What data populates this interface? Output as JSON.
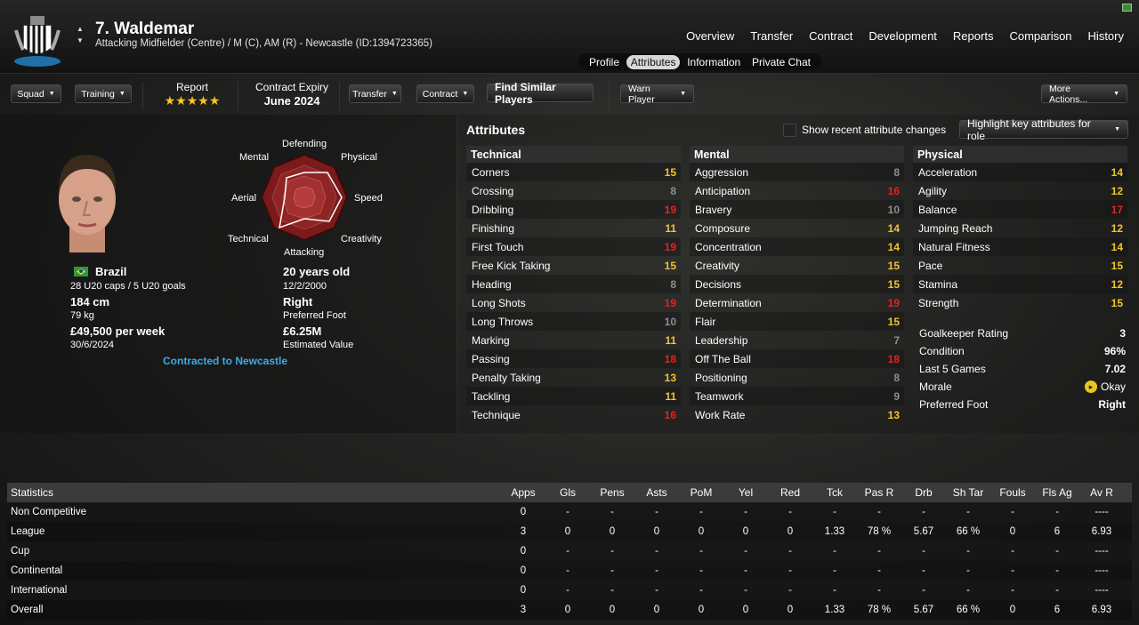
{
  "colors": {
    "accent_yellow": "#f0c52b",
    "accent_red": "#e02424",
    "grey": "#8d8d8d",
    "link_blue": "#3fa9e8"
  },
  "header": {
    "player_name": "7. Waldemar",
    "subtitle": "Attacking Midfielder (Centre) / M (C), AM (R) - Newcastle (ID:1394723365)",
    "nav": [
      "Overview",
      "Transfer",
      "Contract",
      "Development",
      "Reports",
      "Comparison",
      "History"
    ],
    "tabs": [
      "Profile",
      "Attributes",
      "Information",
      "Private Chat"
    ],
    "active_tab": "Attributes"
  },
  "toolbar": {
    "squad": "Squad",
    "training": "Training",
    "report_label": "Report",
    "report_stars": 5,
    "contract_label": "Contract Expiry",
    "contract_value": "June 2024",
    "transfer": "Transfer",
    "contract": "Contract",
    "find_similar": "Find Similar Players",
    "warn": "Warn Player",
    "more": "More Actions..."
  },
  "radar": {
    "labels": [
      "Defending",
      "Physical",
      "Speed",
      "Creativity",
      "Attacking",
      "Technical",
      "Aerial",
      "Mental"
    ]
  },
  "profile": {
    "nationality": "Brazil",
    "caps": "28 U20 caps / 5 U20 goals",
    "height": "184 cm",
    "weight": "79 kg",
    "wage": "£49,500 per week",
    "wage_date": "30/6/2024",
    "age": "20 years old",
    "dob": "12/2/2000",
    "foot": "Right",
    "foot_label": "Preferred Foot",
    "value": "£6.25M",
    "value_label": "Estimated Value",
    "contracted": "Contracted to Newcastle"
  },
  "attributes": {
    "title": "Attributes",
    "show_recent": "Show recent attribute changes",
    "highlight": "Highlight key attributes for role",
    "technical": {
      "title": "Technical",
      "rows": [
        [
          "Corners",
          15
        ],
        [
          "Crossing",
          8
        ],
        [
          "Dribbling",
          19
        ],
        [
          "Finishing",
          11
        ],
        [
          "First Touch",
          19
        ],
        [
          "Free Kick Taking",
          15
        ],
        [
          "Heading",
          8
        ],
        [
          "Long Shots",
          19
        ],
        [
          "Long Throws",
          10
        ],
        [
          "Marking",
          11
        ],
        [
          "Passing",
          18
        ],
        [
          "Penalty Taking",
          13
        ],
        [
          "Tackling",
          11
        ],
        [
          "Technique",
          16
        ]
      ]
    },
    "mental": {
      "title": "Mental",
      "rows": [
        [
          "Aggression",
          8
        ],
        [
          "Anticipation",
          16
        ],
        [
          "Bravery",
          10
        ],
        [
          "Composure",
          14
        ],
        [
          "Concentration",
          14
        ],
        [
          "Creativity",
          15
        ],
        [
          "Decisions",
          15
        ],
        [
          "Determination",
          19
        ],
        [
          "Flair",
          15
        ],
        [
          "Leadership",
          7
        ],
        [
          "Off The Ball",
          18
        ],
        [
          "Positioning",
          8
        ],
        [
          "Teamwork",
          9
        ],
        [
          "Work Rate",
          13
        ]
      ]
    },
    "physical": {
      "title": "Physical",
      "rows": [
        [
          "Acceleration",
          14
        ],
        [
          "Agility",
          12
        ],
        [
          "Balance",
          17
        ],
        [
          "Jumping Reach",
          12
        ],
        [
          "Natural Fitness",
          14
        ],
        [
          "Pace",
          15
        ],
        [
          "Stamina",
          12
        ],
        [
          "Strength",
          15
        ]
      ]
    },
    "info": [
      [
        "Goalkeeper Rating",
        "3"
      ],
      [
        "Condition",
        "96%"
      ],
      [
        "Last 5 Games",
        "7.02"
      ],
      [
        "Morale",
        "Okay"
      ],
      [
        "Preferred Foot",
        "Right"
      ]
    ]
  },
  "stats": {
    "headers": [
      "Statistics",
      "Apps",
      "Gls",
      "Pens",
      "Asts",
      "PoM",
      "Yel",
      "Red",
      "Tck",
      "Pas R",
      "Drb",
      "Sh Tar",
      "Fouls",
      "Fls Ag",
      "Av R"
    ],
    "rows": [
      [
        "Non Competitive",
        "0",
        "-",
        "-",
        "-",
        "-",
        "-",
        "-",
        "-",
        "-",
        "-",
        "-",
        "-",
        "-",
        "----"
      ],
      [
        "League",
        "3",
        "0",
        "0",
        "0",
        "0",
        "0",
        "0",
        "1.33",
        "78 %",
        "5.67",
        "66 %",
        "0",
        "6",
        "6.93"
      ],
      [
        "Cup",
        "0",
        "-",
        "-",
        "-",
        "-",
        "-",
        "-",
        "-",
        "-",
        "-",
        "-",
        "-",
        "-",
        "----"
      ],
      [
        "Continental",
        "0",
        "-",
        "-",
        "-",
        "-",
        "-",
        "-",
        "-",
        "-",
        "-",
        "-",
        "-",
        "-",
        "----"
      ],
      [
        "International",
        "0",
        "-",
        "-",
        "-",
        "-",
        "-",
        "-",
        "-",
        "-",
        "-",
        "-",
        "-",
        "-",
        "----"
      ],
      [
        "Overall",
        "3",
        "0",
        "0",
        "0",
        "0",
        "0",
        "0",
        "1.33",
        "78 %",
        "5.67",
        "66 %",
        "0",
        "6",
        "6.93"
      ]
    ]
  }
}
